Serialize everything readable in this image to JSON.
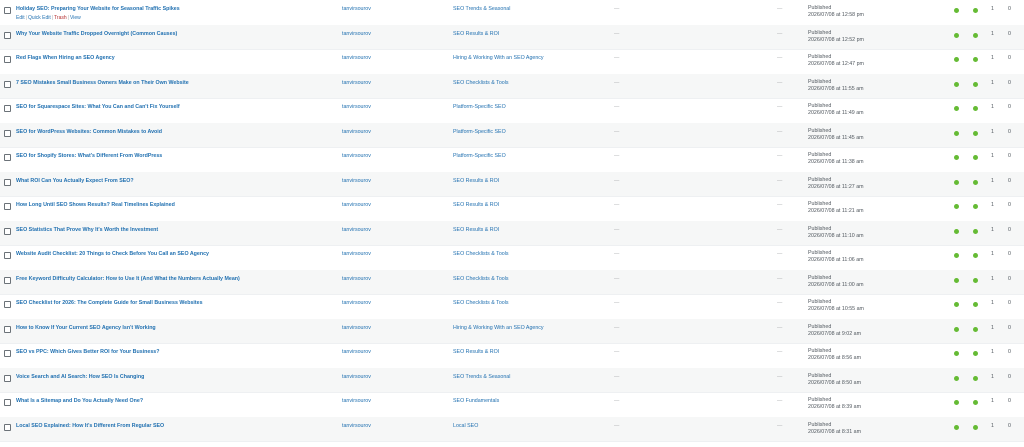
{
  "row_actions": [
    "Edit",
    "Quick Edit",
    "Trash",
    "View"
  ],
  "status_color": "#65bb34",
  "link_color": "#2271b1",
  "posts": [
    {
      "title": "Holiday SEO: Preparing Your Website for Seasonal Traffic Spikes",
      "author": "tanvirsourov",
      "category": "SEO Trends & Seasonal",
      "comments": "—",
      "tags": "—",
      "status": "Published",
      "date": "2026/07/08 at 12:58 pm",
      "count1": "1",
      "count2": "0",
      "show_actions": true
    },
    {
      "title": "Why Your Website Traffic Dropped Overnight (Common Causes)",
      "author": "tanvirsourov",
      "category": "SEO Results & ROI",
      "comments": "—",
      "tags": "—",
      "status": "Published",
      "date": "2026/07/08 at 12:52 pm",
      "count1": "1",
      "count2": "0"
    },
    {
      "title": "Red Flags When Hiring an SEO Agency",
      "author": "tanvirsourov",
      "category": "Hiring & Working With an SEO Agency",
      "comments": "—",
      "tags": "—",
      "status": "Published",
      "date": "2026/07/08 at 12:47 pm",
      "count1": "1",
      "count2": "0"
    },
    {
      "title": "7 SEO Mistakes Small Business Owners Make on Their Own Website",
      "author": "tanvirsourov",
      "category": "SEO Checklists & Tools",
      "comments": "—",
      "tags": "—",
      "status": "Published",
      "date": "2026/07/08 at 11:55 am",
      "count1": "1",
      "count2": "0"
    },
    {
      "title": "SEO for Squarespace Sites: What You Can and Can't Fix Yourself",
      "author": "tanvirsourov",
      "category": "Platform-Specific SEO",
      "comments": "—",
      "tags": "—",
      "status": "Published",
      "date": "2026/07/08 at 11:49 am",
      "count1": "1",
      "count2": "0"
    },
    {
      "title": "SEO for WordPress Websites: Common Mistakes to Avoid",
      "author": "tanvirsourov",
      "category": "Platform-Specific SEO",
      "comments": "—",
      "tags": "—",
      "status": "Published",
      "date": "2026/07/08 at 11:45 am",
      "count1": "1",
      "count2": "0"
    },
    {
      "title": "SEO for Shopify Stores: What's Different From WordPress",
      "author": "tanvirsourov",
      "category": "Platform-Specific SEO",
      "comments": "—",
      "tags": "—",
      "status": "Published",
      "date": "2026/07/08 at 11:38 am",
      "count1": "1",
      "count2": "0"
    },
    {
      "title": "What ROI Can You Actually Expect From SEO?",
      "author": "tanvirsourov",
      "category": "SEO Results & ROI",
      "comments": "—",
      "tags": "—",
      "status": "Published",
      "date": "2026/07/08 at 11:27 am",
      "count1": "1",
      "count2": "0"
    },
    {
      "title": "How Long Until SEO Shows Results? Real Timelines Explained",
      "author": "tanvirsourov",
      "category": "SEO Results & ROI",
      "comments": "—",
      "tags": "—",
      "status": "Published",
      "date": "2026/07/08 at 11:21 am",
      "count1": "1",
      "count2": "0"
    },
    {
      "title": "SEO Statistics That Prove Why It's Worth the Investment",
      "author": "tanvirsourov",
      "category": "SEO Results & ROI",
      "comments": "—",
      "tags": "—",
      "status": "Published",
      "date": "2026/07/08 at 11:10 am",
      "count1": "1",
      "count2": "0"
    },
    {
      "title": "Website Audit Checklist: 20 Things to Check Before You Call an SEO Agency",
      "author": "tanvirsourov",
      "category": "SEO Checklists & Tools",
      "comments": "—",
      "tags": "—",
      "status": "Published",
      "date": "2026/07/08 at 11:06 am",
      "count1": "1",
      "count2": "0"
    },
    {
      "title": "Free Keyword Difficulty Calculator: How to Use It (And What the Numbers Actually Mean)",
      "author": "tanvirsourov",
      "category": "SEO Checklists & Tools",
      "comments": "—",
      "tags": "—",
      "status": "Published",
      "date": "2026/07/08 at 11:00 am",
      "count1": "1",
      "count2": "0"
    },
    {
      "title": "SEO Checklist for 2026: The Complete Guide for Small Business Websites",
      "author": "tanvirsourov",
      "category": "SEO Checklists & Tools",
      "comments": "—",
      "tags": "—",
      "status": "Published",
      "date": "2026/07/08 at 10:55 am",
      "count1": "1",
      "count2": "0"
    },
    {
      "title": "How to Know If Your Current SEO Agency Isn't Working",
      "author": "tanvirsourov",
      "category": "Hiring & Working With an SEO Agency",
      "comments": "—",
      "tags": "—",
      "status": "Published",
      "date": "2026/07/08 at 9:02 am",
      "count1": "1",
      "count2": "0"
    },
    {
      "title": "SEO vs PPC: Which Gives Better ROI for Your Business?",
      "author": "tanvirsourov",
      "category": "SEO Results & ROI",
      "comments": "—",
      "tags": "—",
      "status": "Published",
      "date": "2026/07/08 at 8:56 am",
      "count1": "1",
      "count2": "0"
    },
    {
      "title": "Voice Search and AI Search: How SEO Is Changing",
      "author": "tanvirsourov",
      "category": "SEO Trends & Seasonal",
      "comments": "—",
      "tags": "—",
      "status": "Published",
      "date": "2026/07/08 at 8:50 am",
      "count1": "1",
      "count2": "0"
    },
    {
      "title": "What Is a Sitemap and Do You Actually Need One?",
      "author": "tanvirsourov",
      "category": "SEO Fundamentals",
      "comments": "—",
      "tags": "—",
      "status": "Published",
      "date": "2026/07/08 at 8:39 am",
      "count1": "1",
      "count2": "0"
    },
    {
      "title": "Local SEO Explained: How It's Different From Regular SEO",
      "author": "tanvirsourov",
      "category": "Local SEO",
      "comments": "—",
      "tags": "—",
      "status": "Published",
      "date": "2026/07/08 at 8:31 am",
      "count1": "1",
      "count2": "0"
    }
  ]
}
